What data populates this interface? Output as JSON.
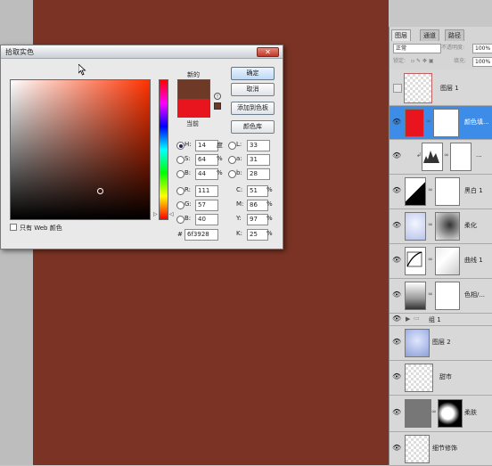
{
  "colors": {
    "canvas": "#7a3324",
    "new_color": "#6f3928",
    "current_color": "#e8141e",
    "accent": "#3d8de8"
  },
  "dialog": {
    "title": "拾取实色",
    "close_icon": "close-icon",
    "new_label": "新的",
    "current_label": "当前",
    "buttons": {
      "ok": "确定",
      "cancel": "取消",
      "add_to_swatches": "添加到色板",
      "color_libraries": "颜色库"
    },
    "only_web_colors": "只有 Web 颜色",
    "hsb": [
      {
        "label": "H:",
        "value": "14",
        "unit": "度",
        "selected": true
      },
      {
        "label": "S:",
        "value": "64",
        "unit": "%",
        "selected": false
      },
      {
        "label": "B:",
        "value": "44",
        "unit": "%",
        "selected": false
      }
    ],
    "rgb": [
      {
        "label": "R:",
        "value": "111"
      },
      {
        "label": "G:",
        "value": "57"
      },
      {
        "label": "B:",
        "value": "40"
      }
    ],
    "lab": [
      {
        "label": "L:",
        "value": "33"
      },
      {
        "label": "a:",
        "value": "31"
      },
      {
        "label": "b:",
        "value": "28"
      }
    ],
    "cmyk": [
      {
        "label": "C:",
        "value": "51",
        "unit": "%"
      },
      {
        "label": "M:",
        "value": "86",
        "unit": "%"
      },
      {
        "label": "Y:",
        "value": "97",
        "unit": "%"
      },
      {
        "label": "K:",
        "value": "25",
        "unit": "%"
      }
    ],
    "hex_label": "#",
    "hex_value": "6f3928"
  },
  "layers_panel": {
    "tabs": [
      "图层",
      "通道",
      "路径"
    ],
    "blend_mode": "正常",
    "opacity_label": "不透明度:",
    "opacity_value": "100%",
    "lock_label": "锁定:",
    "fill_label": "填充:",
    "fill_value": "100%",
    "layers": [
      {
        "name": "图层 1"
      },
      {
        "name": "颜色填..."
      },
      {
        "name": "..."
      },
      {
        "name": "黑白 1"
      },
      {
        "name": "柔化"
      },
      {
        "name": "曲线 1"
      },
      {
        "name": "色相/..."
      },
      {
        "name": "组 1"
      },
      {
        "name": "图层 2"
      },
      {
        "name": "甜市"
      },
      {
        "name": "柔肤"
      },
      {
        "name": "细节修饰"
      }
    ]
  }
}
